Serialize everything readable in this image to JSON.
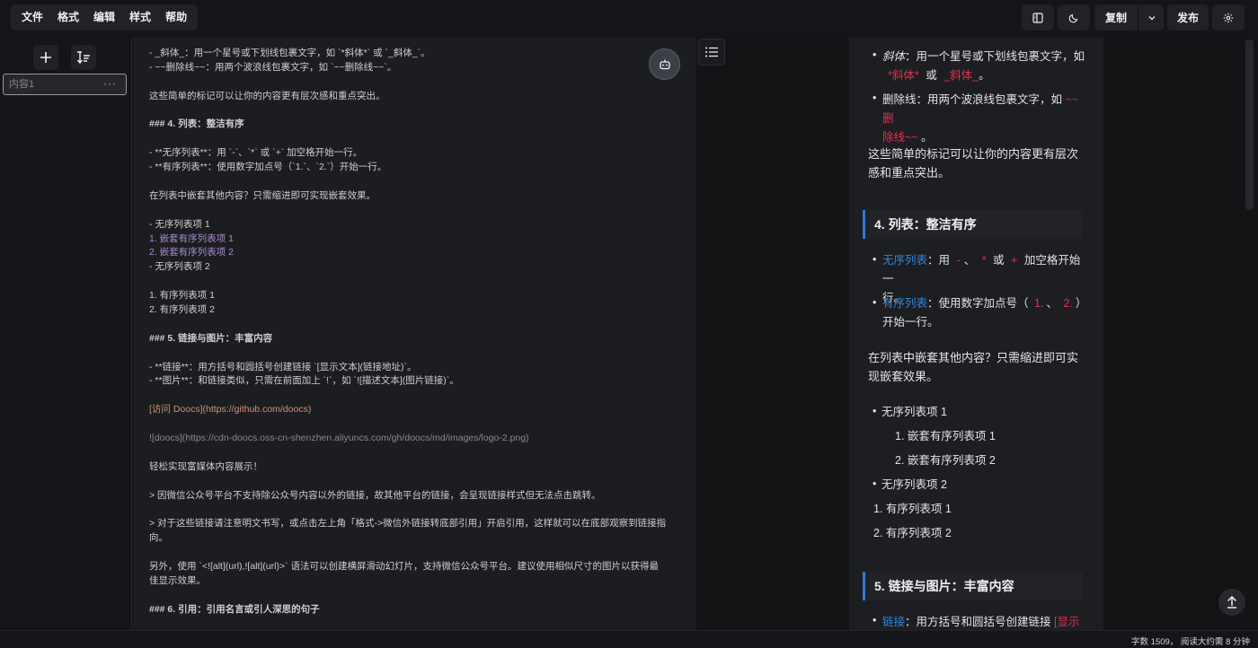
{
  "menu": [
    "文件",
    "格式",
    "编辑",
    "样式",
    "帮助"
  ],
  "toolbar": {
    "copy_label": "复制",
    "publish_label": "发布"
  },
  "sidebar": {
    "doc_name": "内容1",
    "doc_more": "···"
  },
  "editor": {
    "lines": [
      {
        "t": "- _斜体_：用一个星号或下划线包裹文字，如 `*斜体*` 或 `_斜体_`。",
        "c": ""
      },
      {
        "t": "- ~~删除线~~：用两个波浪线包裹文字，如 `~~删除线~~`。",
        "c": ""
      },
      {
        "t": "",
        "c": ""
      },
      {
        "t": "这些简单的标记可以让你的内容更有层次感和重点突出。",
        "c": ""
      },
      {
        "t": "",
        "c": ""
      },
      {
        "t": "### 4. 列表：整洁有序",
        "c": "b"
      },
      {
        "t": "",
        "c": ""
      },
      {
        "t": "- **无序列表**：用 `-`、`*` 或 `+` 加空格开始一行。",
        "c": ""
      },
      {
        "t": "- **有序列表**：使用数字加点号（`1.`、`2.`）开始一行。",
        "c": ""
      },
      {
        "t": "",
        "c": ""
      },
      {
        "t": "在列表中嵌套其他内容？只需缩进即可实现嵌套效果。",
        "c": ""
      },
      {
        "t": "",
        "c": ""
      },
      {
        "t": "- 无序列表项 1",
        "c": ""
      },
      {
        "t": "  1. 嵌套有序列表项 1",
        "c": "purple"
      },
      {
        "t": "  2. 嵌套有序列表项 2",
        "c": "purple"
      },
      {
        "t": "- 无序列表项 2",
        "c": ""
      },
      {
        "t": "",
        "c": ""
      },
      {
        "t": "1. 有序列表项 1",
        "c": ""
      },
      {
        "t": "2. 有序列表项 2",
        "c": ""
      },
      {
        "t": "",
        "c": ""
      },
      {
        "t": "### 5. 链接与图片：丰富内容",
        "c": "b"
      },
      {
        "t": "",
        "c": ""
      },
      {
        "t": "- **链接**：用方括号和圆括号创建链接 `[显示文本](链接地址)`。",
        "c": ""
      },
      {
        "t": "- **图片**：和链接类似，只需在前面加上 `!`，如 `![描述文本](图片链接)`。",
        "c": ""
      },
      {
        "t": "",
        "c": ""
      },
      {
        "t": "[访问 Doocs](https://github.com/doocs)",
        "c": "link"
      },
      {
        "t": "",
        "c": ""
      },
      {
        "t": "![doocs](https://cdn-doocs.oss-cn-shenzhen.aliyuncs.com/gh/doocs/md/images/logo-2.png)",
        "c": "img"
      },
      {
        "t": "",
        "c": ""
      },
      {
        "t": "轻松实现富媒体内容展示！",
        "c": ""
      },
      {
        "t": "",
        "c": ""
      },
      {
        "t": "> 因微信公众号平台不支持除公众号内容以外的链接，故其他平台的链接，会呈现链接样式但无法点击跳转。",
        "c": ""
      },
      {
        "t": "",
        "c": ""
      },
      {
        "t": "> 对于这些链接请注意明文书写，或点击左上角「格式->微信外链接转底部引用」开启引用，这样就可以在底部观察到链接指",
        "c": ""
      },
      {
        "t": "向。",
        "c": ""
      },
      {
        "t": "",
        "c": ""
      },
      {
        "t": "另外，使用 `<![alt](url),![alt](url)>` 语法可以创建横屏滑动幻灯片，支持微信公众号平台。建议使用相似尺寸的图片以获得最",
        "c": ""
      },
      {
        "t": "佳显示效果。",
        "c": ""
      },
      {
        "t": "",
        "c": ""
      },
      {
        "t": "### 6. 引用：引用名言或引人深思的句子",
        "c": "b"
      }
    ]
  },
  "preview": {
    "italic_label": "斜体",
    "italic_desc": "：用一个星号或下划线包裹文字，如",
    "italic_code1": "*斜体*",
    "or": "或",
    "italic_code2": "_斜体_",
    "period": "。",
    "strike_label": "删除线",
    "strike_desc": "：用两个波浪线包裹文字，如",
    "strike_code_a": "~~删",
    "strike_code_b": "除线~~",
    "para1_a": "这些简单的标记可以让你的内容更有层次",
    "para1_b": "感和重点突出。",
    "h4": "4. 列表：整洁有序",
    "ul_label": "无序列表",
    "ul_desc_a": "：用",
    "ul_code1": "-",
    "ul_sep": "、",
    "ul_code2": "*",
    "ul_or": "或",
    "ul_code3": "+",
    "ul_desc_b": "加空格开始一",
    "ul_desc_c": "行。",
    "ol_label": "有序列表",
    "ol_desc_a": "：使用数字加点号（",
    "ol_code1": "1.",
    "ol_sep": "、",
    "ol_code2": "2.",
    "ol_close": "）",
    "ol_desc_b": "开始一行。",
    "para2_a": "在列表中嵌套其他内容？只需缩进即可实",
    "para2_b": "现嵌套效果。",
    "item_u1": "无序列表项 1",
    "item_n1": "1. 嵌套有序列表项 1",
    "item_n2": "2. 嵌套有序列表项 2",
    "item_u2": "无序列表项 2",
    "item_o1": "1. 有序列表项 1",
    "item_o2": "2. 有序列表项 2",
    "h5": "5. 链接与图片：丰富内容",
    "link_label": "链接",
    "link_desc": "：用方括号和圆括号创建链接",
    "link_code": "[显示"
  },
  "status": {
    "text": "字数 1509， 阅读大约需 8 分钟"
  }
}
